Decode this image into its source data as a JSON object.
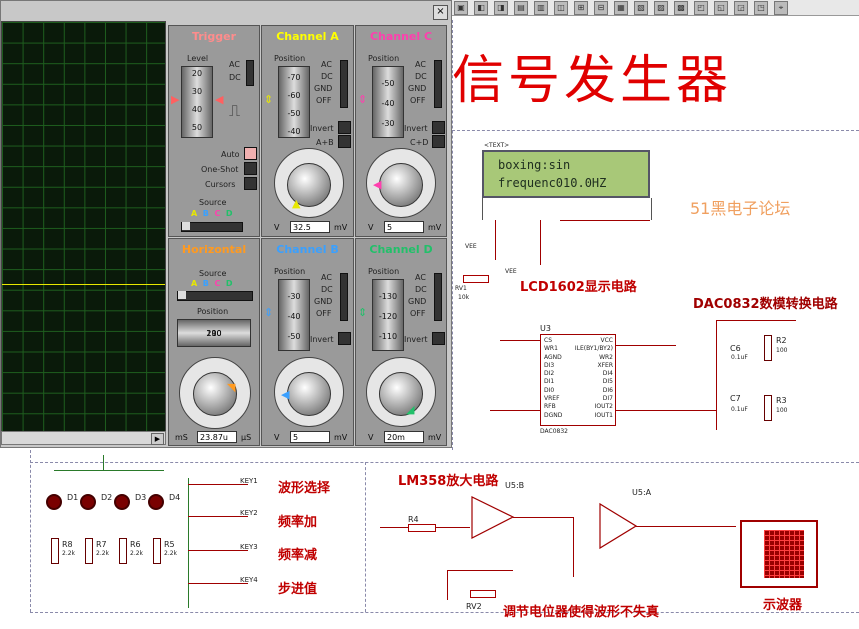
{
  "schematic": {
    "title": "信号发生器",
    "lcd_text_label": "<TEXT>",
    "lcd_line1": "boxing:sin",
    "lcd_line2": "frequenc010.0HZ",
    "watermark": "51黑电子论坛",
    "lcd_section_label": "LCD1602显示电路",
    "dac_section_label": "DAC0832数模转换电路",
    "amp_section_label": "LM358放大电路",
    "pot_note": "调节电位器使得波形不失真",
    "scope_label": "示波器",
    "key_labels": [
      "波形选择",
      "频率加",
      "频率减",
      "步进值"
    ],
    "key_names": [
      "KEY1",
      "KEY2",
      "KEY3",
      "KEY4"
    ],
    "led_names": [
      "D1",
      "D2",
      "D3",
      "D4"
    ],
    "resistor_names": [
      "R8",
      "R7",
      "R6",
      "R5"
    ],
    "resistor_values": [
      "2.2k",
      "2.2k",
      "2.2k",
      "2.2k"
    ],
    "chip_u3": "U3",
    "chip_u3_name": "DAC0832",
    "u5b": "U5:B",
    "u5a": "U5:A",
    "rv1": "RV1",
    "rv2": "RV2",
    "r4": "R4",
    "r2": "R2",
    "r3": "R3",
    "c6": "C6",
    "c7": "C7",
    "vee": "VEE",
    "rv1_value": "10k",
    "r2_value": "100",
    "r3_value": "100",
    "c6_value": "0.1uF",
    "c7_value": "0.1uF",
    "u3_pins_left": [
      "CS",
      "WR1",
      "AGND",
      "DI3",
      "DI2",
      "DI1",
      "DI0",
      "VREF",
      "RFB",
      "DGND"
    ],
    "u3_pins_right": [
      "VCC",
      "ILE(BY1/BY2)",
      "WR2",
      "XFER",
      "DI4",
      "DI5",
      "DI6",
      "DI7",
      "IOUT2",
      "IOUT1"
    ]
  },
  "scope": {
    "close_label": "×",
    "trigger": {
      "title": "Trigger",
      "level_label": "Level",
      "level_ticks": [
        "20",
        "30",
        "40",
        "50"
      ],
      "ac": "AC",
      "dc": "DC",
      "auto": "Auto",
      "one_shot": "One-Shot",
      "cursors": "Cursors",
      "source_label": "Source",
      "source_options": [
        "A",
        "B",
        "C",
        "D"
      ]
    },
    "channel_a": {
      "title": "Channel A",
      "position_label": "Position",
      "ticks": [
        "-70",
        "-60",
        "-50",
        "-40"
      ],
      "ac": "AC",
      "dc": "DC",
      "gnd": "GND",
      "off": "OFF",
      "invert": "Invert",
      "combine": "A+B",
      "value": "32.5",
      "unit_left": "V",
      "unit_right": "mV",
      "dial_marks": [
        "20",
        "10",
        "5",
        "2",
        "1",
        "0.5",
        "0.2",
        "0.1",
        "50",
        "20",
        "10",
        "5",
        "2"
      ]
    },
    "channel_c": {
      "title": "Channel C",
      "position_label": "Position",
      "ticks": [
        "-50",
        "-40",
        "-30"
      ],
      "ac": "AC",
      "dc": "DC",
      "gnd": "GND",
      "off": "OFF",
      "invert": "Invert",
      "combine": "C+D",
      "value": "5",
      "unit_left": "V",
      "unit_right": "mV"
    },
    "horizontal": {
      "title": "Horizontal",
      "source_label": "Source",
      "source_options": [
        "A",
        "B",
        "C",
        "D"
      ],
      "position_label": "Position",
      "ticks": [
        "210",
        "200",
        "190"
      ],
      "value": "23.87u",
      "unit_left": "mS",
      "unit_right": "µS",
      "dial_marks": [
        "0.5",
        "0.2",
        "0.1",
        "50",
        "20",
        "10",
        "5",
        "2",
        "1"
      ]
    },
    "channel_b": {
      "title": "Channel B",
      "position_label": "Position",
      "ticks": [
        "-30",
        "-40",
        "-50"
      ],
      "ac": "AC",
      "dc": "DC",
      "gnd": "GND",
      "off": "OFF",
      "invert": "Invert",
      "value": "5",
      "unit_left": "V",
      "unit_right": "mV"
    },
    "channel_d": {
      "title": "Channel D",
      "position_label": "Position",
      "ticks": [
        "-130",
        "-120",
        "-110"
      ],
      "ac": "AC",
      "dc": "DC",
      "gnd": "GND",
      "off": "OFF",
      "invert": "Invert",
      "value": "20m",
      "unit_left": "V",
      "unit_right": "mV"
    }
  },
  "colors": {
    "trigger": "#ff8c8c",
    "channel_a": "#ffff00",
    "channel_b": "#3aa0ff",
    "channel_c": "#ff3fae",
    "channel_d": "#22c06a",
    "horizontal": "#ff9a20",
    "schematic_red": "#d40000"
  }
}
